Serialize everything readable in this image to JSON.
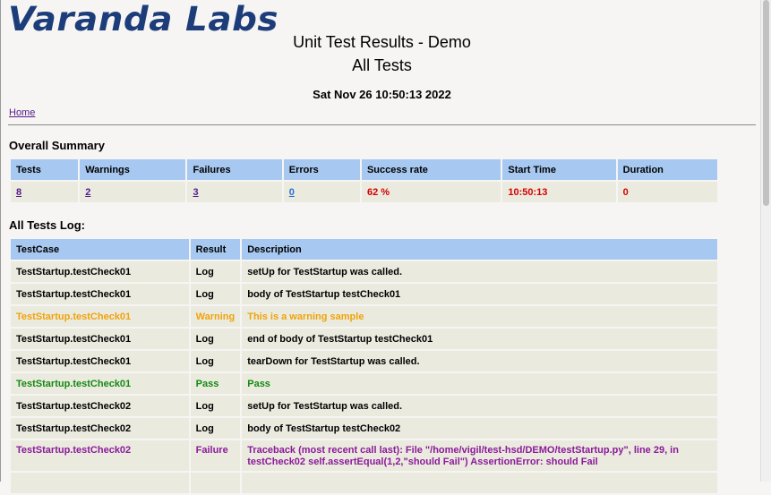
{
  "header": {
    "logo_text": "Varanda Labs",
    "title_line1": "Unit Test Results - Demo",
    "title_line2": "All Tests",
    "date": "Sat Nov 26 10:50:13 2022",
    "home_link": "Home"
  },
  "summary": {
    "heading": "Overall Summary",
    "columns": [
      "Tests",
      "Warnings",
      "Failures",
      "Errors",
      "Success rate",
      "Start Time",
      "Duration"
    ],
    "values": {
      "tests": "8",
      "warnings": "2",
      "failures": "3",
      "errors": "0",
      "success_rate": "62 %",
      "start_time": "10:50:13",
      "duration": "0"
    }
  },
  "log": {
    "heading": "All Tests Log:",
    "columns": [
      "TestCase",
      "Result",
      "Description"
    ],
    "rows": [
      {
        "testcase": "TestStartup.testCheck01",
        "result": "Log",
        "description": "setUp for TestStartup was called."
      },
      {
        "testcase": "TestStartup.testCheck01",
        "result": "Log",
        "description": "body of TestStartup testCheck01"
      },
      {
        "testcase": "TestStartup.testCheck01",
        "result": "Warning",
        "description": "This is a warning sample"
      },
      {
        "testcase": "TestStartup.testCheck01",
        "result": "Log",
        "description": "end of body of TestStartup testCheck01"
      },
      {
        "testcase": "TestStartup.testCheck01",
        "result": "Log",
        "description": "tearDown for TestStartup was called."
      },
      {
        "testcase": "TestStartup.testCheck01",
        "result": "Pass",
        "description": "Pass"
      },
      {
        "testcase": "TestStartup.testCheck02",
        "result": "Log",
        "description": "setUp for TestStartup was called."
      },
      {
        "testcase": "TestStartup.testCheck02",
        "result": "Log",
        "description": "body of TestStartup testCheck02"
      },
      {
        "testcase": "TestStartup.testCheck02",
        "result": "Failure",
        "description": "Traceback (most recent call last): File \"/home/vigil/test-hsd/DEMO/testStartup.py\", line 29, in testCheck02 self.assertEqual(1,2,\"should Fail\") AssertionError: should Fail"
      }
    ]
  },
  "colors": {
    "logo": "#1d3d7a",
    "header_cell": "#a7c8f0",
    "body_cell": "#ebeadf",
    "warning": "#f0a30a",
    "pass": "#138a13",
    "failure": "#8b1a9a",
    "stat_red": "#d40000"
  }
}
